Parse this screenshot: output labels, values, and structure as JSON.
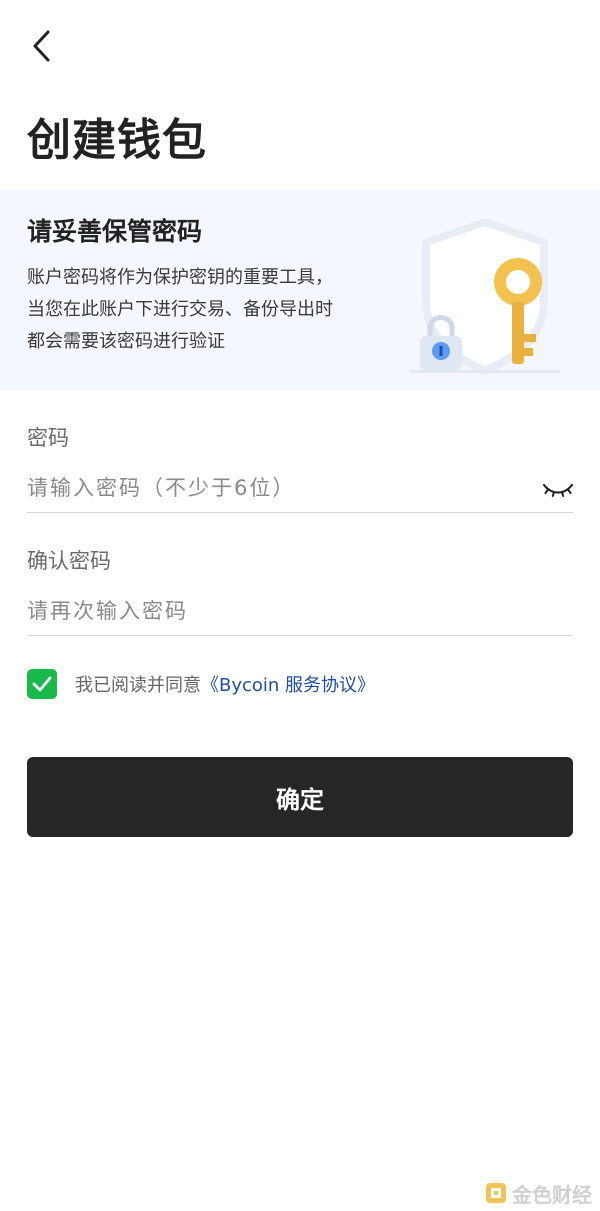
{
  "header": {
    "title": "创建钱包"
  },
  "info_card": {
    "title": "请妥善保管密码",
    "description_lines": [
      "账户密码将作为保护密钥的重要工具，",
      "当您在此账户下进行交易、备份导出时",
      "都会需要该密码进行验证"
    ]
  },
  "password_field": {
    "label": "密码",
    "placeholder": "请输入密码（不少于6位）",
    "value": ""
  },
  "confirm_field": {
    "label": "确认密码",
    "placeholder": "请再次输入密码",
    "value": ""
  },
  "agreement": {
    "checked": true,
    "prefix": "我已阅读并同意",
    "link_text": "《Bycoin 服务协议》"
  },
  "confirm_button": {
    "label": "确定"
  },
  "watermark": {
    "text": "金色财经"
  },
  "colors": {
    "checkbox": "#18b84a",
    "link": "#1d4fa3",
    "button": "#262626",
    "card_bg": "#f4f7fd"
  }
}
